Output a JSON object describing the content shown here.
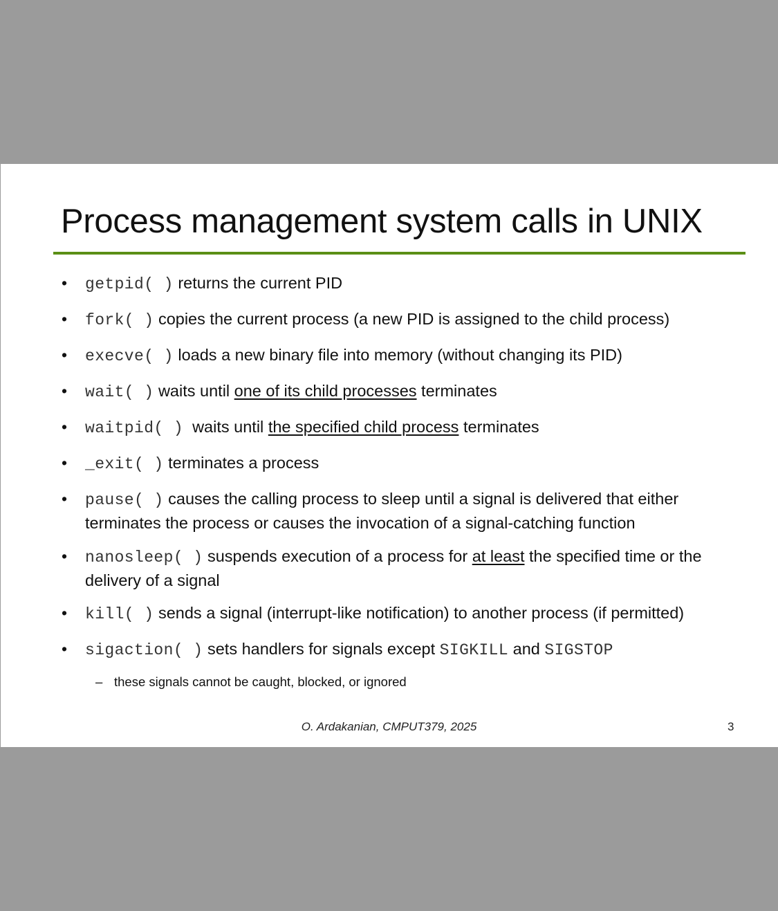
{
  "slide": {
    "title": "Process management system calls in UNIX",
    "accent_color": "#5b8f16",
    "background_color": "#9b9b9b",
    "bullet_glyph": "•",
    "bullets": [
      {
        "code": "getpid( )",
        "text": " returns the current PID"
      },
      {
        "code": "fork( )",
        "text": " copies the current process (a new PID is assigned to the child process)"
      },
      {
        "code": "execve( )",
        "text": " loads a new binary file into memory (without changing its PID)"
      },
      {
        "code": "wait( )",
        "text_before": " waits until ",
        "underlined": "one of its child processes",
        "text_after": " terminates"
      },
      {
        "code": "waitpid( )",
        "text_before": "  waits until ",
        "underlined": "the specified child process",
        "text_after": " terminates"
      },
      {
        "code": "_exit( )",
        "text": " terminates a process"
      },
      {
        "code": "pause( )",
        "text": " causes the calling process to sleep until a signal is delivered that either terminates the process or causes the invocation of a signal-catching function"
      },
      {
        "code": "nanosleep( )",
        "text_before": " suspends execution of a process for ",
        "underlined": "at least",
        "text_after": " the specified time or the delivery of a signal"
      },
      {
        "code": "kill( )",
        "text": " sends a signal (interrupt-like notification) to another process (if permitted)"
      },
      {
        "code": "sigaction( )",
        "text_before": " sets handlers for signals except ",
        "code2": "SIGKILL",
        "text_mid": " and ",
        "code3": "SIGSTOP"
      }
    ],
    "sub_bullet": {
      "dash": "–",
      "text": "these signals cannot be caught, blocked, or ignored"
    },
    "footer": "O. Ardakanian, CMPUT379, 2025",
    "page_number": "3"
  }
}
